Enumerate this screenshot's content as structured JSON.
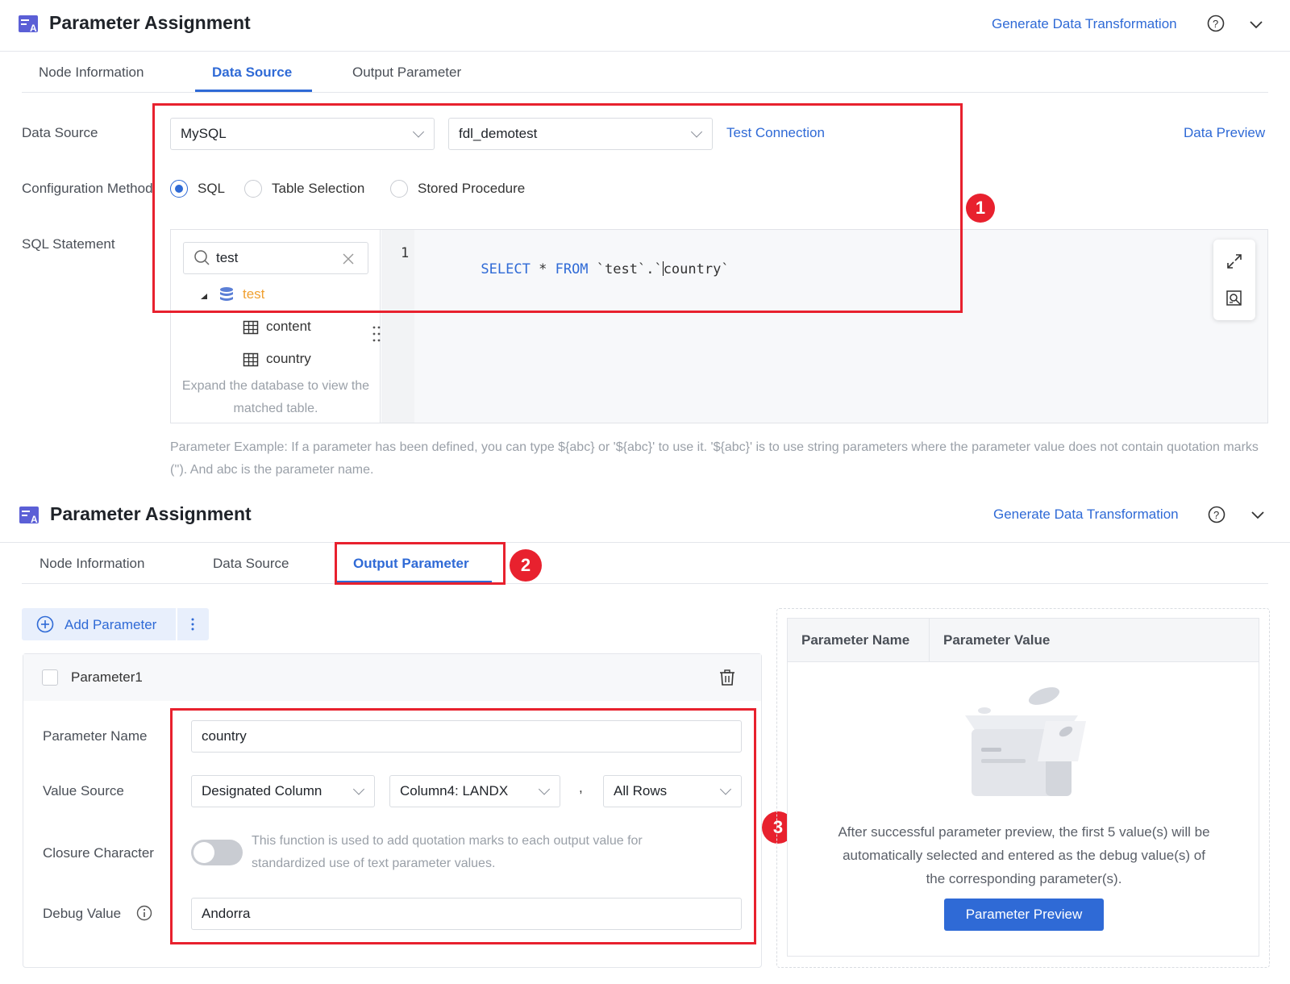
{
  "panel1": {
    "title": "Parameter Assignment",
    "generate_link": "Generate Data Transformation",
    "help_icon": "help-circle-icon",
    "collapse_icon": "chevron-down-icon",
    "tabs": [
      {
        "label": "Node Information",
        "active": false
      },
      {
        "label": "Data Source",
        "active": true
      },
      {
        "label": "Output Parameter",
        "active": false
      }
    ],
    "data_source": {
      "label": "Data Source",
      "type_value": "MySQL",
      "connection_value": "fdl_demotest",
      "test_connection": "Test Connection",
      "data_preview": "Data Preview"
    },
    "config_method": {
      "label": "Configuration Method",
      "options": [
        "SQL",
        "Table Selection",
        "Stored Procedure"
      ],
      "selected": "SQL"
    },
    "sql": {
      "label": "SQL Statement",
      "search_value": "test",
      "tree": {
        "database": "test",
        "tables": [
          "content",
          "country"
        ],
        "hint": "Expand the database to view the matched table."
      },
      "line_number": "1",
      "code": {
        "keyword1": "SELECT",
        "star": "*",
        "keyword2": "FROM",
        "rest_a": "`test`.`",
        "rest_b": "country`"
      }
    },
    "param_example": "Parameter Example: If a parameter has been defined, you can type ${abc} or '${abc}' to use it. '${abc}' is to use string parameters where the parameter value does not contain quotation marks (''). And abc is the parameter name."
  },
  "panel2": {
    "title": "Parameter Assignment",
    "generate_link": "Generate Data Transformation",
    "tabs": [
      {
        "label": "Node Information",
        "active": false
      },
      {
        "label": "Data Source",
        "active": false
      },
      {
        "label": "Output Parameter",
        "active": true
      }
    ],
    "add_parameter": "Add Parameter",
    "parameter": {
      "name_header": "Parameter1",
      "name_label": "Parameter Name",
      "name_value": "country",
      "value_source_label": "Value Source",
      "value_source": "Designated Column",
      "column": "Column4: LANDX",
      "separator": ",",
      "rows": "All Rows",
      "closure_label": "Closure Character",
      "closure_enabled": false,
      "closure_hint": "This function is used to add quotation marks to each output value for standardized use of text parameter values.",
      "debug_label": "Debug Value",
      "debug_value": "Andorra"
    },
    "preview": {
      "col_name": "Parameter Name",
      "col_value": "Parameter Value",
      "empty_text": "After successful parameter preview, the first 5 value(s) will be automatically selected and entered as the debug value(s) of the corresponding parameter(s).",
      "button": "Parameter Preview"
    }
  },
  "callouts": [
    "1",
    "2",
    "3"
  ],
  "colors": {
    "accent": "#2f6ad6",
    "annotation": "#e8212e",
    "muted": "#9aa0a8"
  }
}
